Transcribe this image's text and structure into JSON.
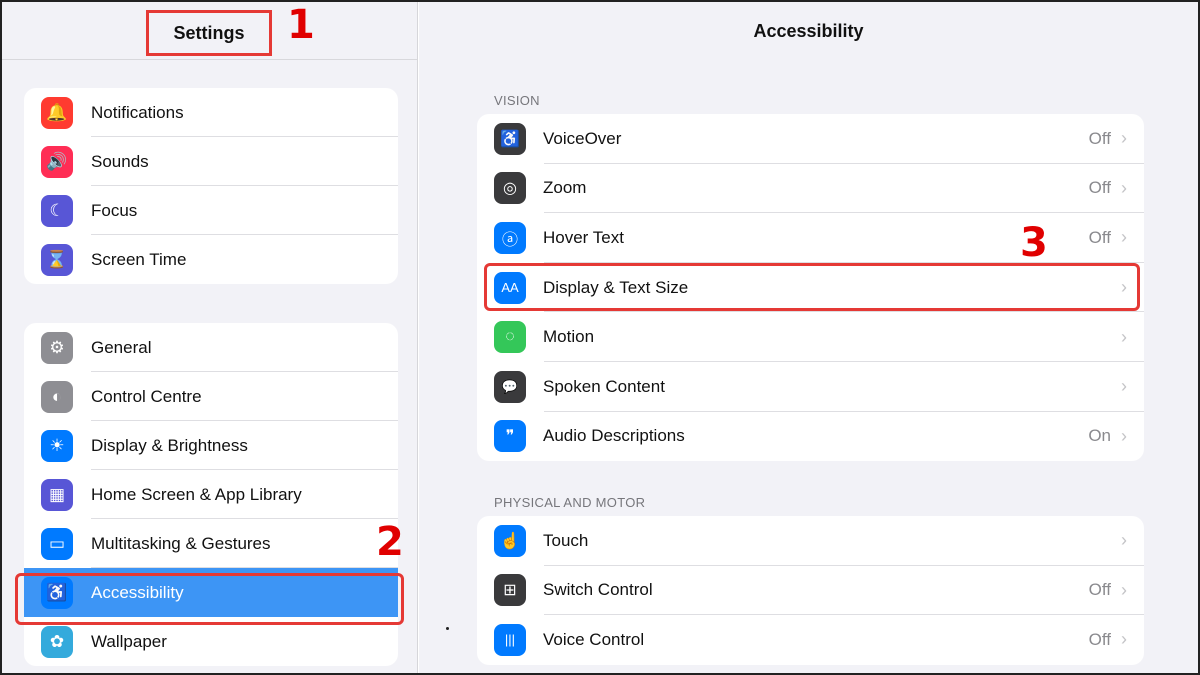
{
  "sidebar": {
    "title": "Settings",
    "group1": [
      {
        "label": "Notifications",
        "icon": "bell-icon",
        "color": "#ff3b30",
        "glyph": "🔔"
      },
      {
        "label": "Sounds",
        "icon": "speaker-icon",
        "color": "#ff2d55",
        "glyph": "🔊"
      },
      {
        "label": "Focus",
        "icon": "moon-icon",
        "color": "#5856d6",
        "glyph": "☾"
      },
      {
        "label": "Screen Time",
        "icon": "hourglass-icon",
        "color": "#5856d6",
        "glyph": "⌛"
      }
    ],
    "group2": [
      {
        "label": "General",
        "icon": "gear-icon",
        "color": "#8e8e93",
        "glyph": "⚙"
      },
      {
        "label": "Control Centre",
        "icon": "toggles-icon",
        "color": "#8e8e93",
        "glyph": "◐"
      },
      {
        "label": "Display & Brightness",
        "icon": "sun-icon",
        "color": "#007aff",
        "glyph": "☀"
      },
      {
        "label": "Home Screen & App Library",
        "icon": "grid-icon",
        "color": "#5856d6",
        "glyph": "▦"
      },
      {
        "label": "Multitasking & Gestures",
        "icon": "multitasking-icon",
        "color": "#007aff",
        "glyph": "▭"
      },
      {
        "label": "Accessibility",
        "icon": "accessibility-icon",
        "color": "#007aff",
        "glyph": "♿",
        "active": true
      },
      {
        "label": "Wallpaper",
        "icon": "flower-icon",
        "color": "#34aadc",
        "glyph": "✿"
      }
    ]
  },
  "main": {
    "title": "Accessibility",
    "vision_header": "VISION",
    "vision": [
      {
        "label": "VoiceOver",
        "value": "Off",
        "icon": "voiceover-icon",
        "color": "#3a3a3c",
        "glyph": "♿"
      },
      {
        "label": "Zoom",
        "value": "Off",
        "icon": "zoom-icon",
        "color": "#3a3a3c",
        "glyph": "◎"
      },
      {
        "label": "Hover Text",
        "value": "Off",
        "icon": "hover-text-icon",
        "color": "#007aff",
        "glyph": "ⓐ"
      },
      {
        "label": "Display & Text Size",
        "value": "",
        "icon": "text-size-icon",
        "color": "#007aff",
        "glyph": "AA"
      },
      {
        "label": "Motion",
        "value": "",
        "icon": "motion-icon",
        "color": "#34c759",
        "glyph": "◌"
      },
      {
        "label": "Spoken Content",
        "value": "",
        "icon": "spoken-content-icon",
        "color": "#3a3a3c",
        "glyph": "💬"
      },
      {
        "label": "Audio Descriptions",
        "value": "On",
        "icon": "audio-descriptions-icon",
        "color": "#007aff",
        "glyph": "❞"
      }
    ],
    "motor_header": "PHYSICAL AND MOTOR",
    "motor": [
      {
        "label": "Touch",
        "value": "",
        "icon": "hand-touch-icon",
        "color": "#007aff",
        "glyph": "☝"
      },
      {
        "label": "Switch Control",
        "value": "Off",
        "icon": "switch-control-icon",
        "color": "#3a3a3c",
        "glyph": "⊞"
      },
      {
        "label": "Voice Control",
        "value": "Off",
        "icon": "voice-control-icon",
        "color": "#007aff",
        "glyph": "|||"
      }
    ],
    "chevron": "›"
  },
  "annotations": {
    "one": "1",
    "two": "2",
    "three": "3"
  },
  "colors": {
    "highlight": "#e53935",
    "active_row": "#3d95f5",
    "accent": "#007aff"
  }
}
